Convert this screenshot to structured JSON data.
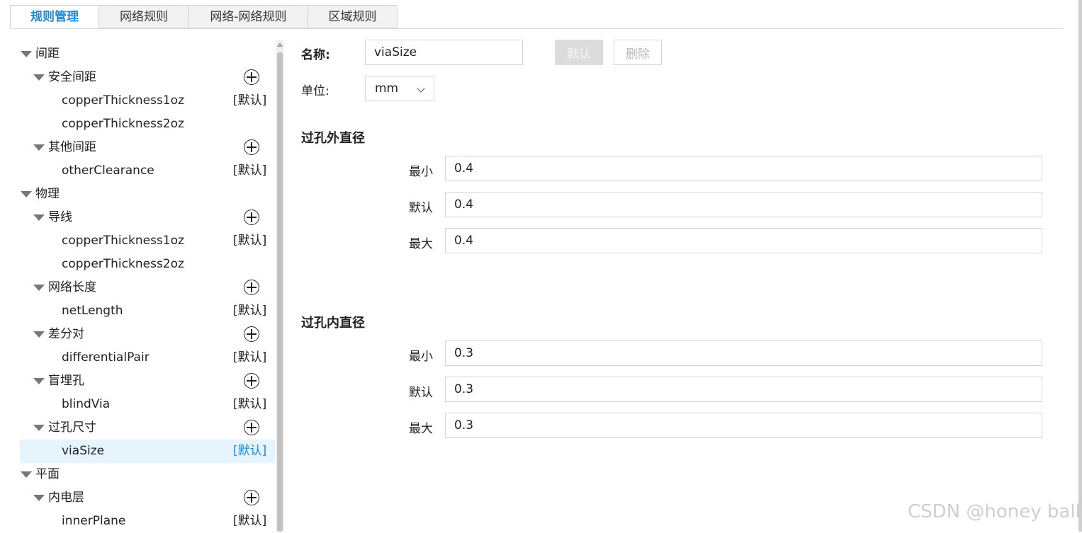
{
  "tabs": [
    "规则管理",
    "网络规则",
    "网络-网络规则",
    "区域规则"
  ],
  "tree": {
    "default_tag": "[默认]",
    "rows": [
      {
        "label": "间距"
      },
      {
        "label": "安全间距"
      },
      {
        "label": "copperThickness1oz"
      },
      {
        "label": "copperThickness2oz"
      },
      {
        "label": "其他间距"
      },
      {
        "label": "otherClearance"
      },
      {
        "label": "物理"
      },
      {
        "label": "导线"
      },
      {
        "label": "copperThickness1oz"
      },
      {
        "label": "copperThickness2oz"
      },
      {
        "label": "网络长度"
      },
      {
        "label": "netLength"
      },
      {
        "label": "差分对"
      },
      {
        "label": "differentialPair"
      },
      {
        "label": "盲埋孔"
      },
      {
        "label": "blindVia"
      },
      {
        "label": "过孔尺寸"
      },
      {
        "label": "viaSize"
      },
      {
        "label": "平面"
      },
      {
        "label": "内电层"
      },
      {
        "label": "innerPlane"
      }
    ]
  },
  "form": {
    "name_label": "名称:",
    "name_value": "viaSize",
    "default_button": "默认",
    "delete_button": "删除",
    "unit_label": "单位:",
    "unit_value": "mm",
    "outer": {
      "title": "过孔外直径",
      "min_label": "最小",
      "min_value": "0.4",
      "default_label": "默认",
      "default_value": "0.4",
      "max_label": "最大",
      "max_value": "0.4"
    },
    "inner": {
      "title": "过孔内直径",
      "min_label": "最小",
      "min_value": "0.3",
      "default_label": "默认",
      "default_value": "0.3",
      "max_label": "最大",
      "max_value": "0.3"
    }
  },
  "watermark": "CSDN @honey ball"
}
